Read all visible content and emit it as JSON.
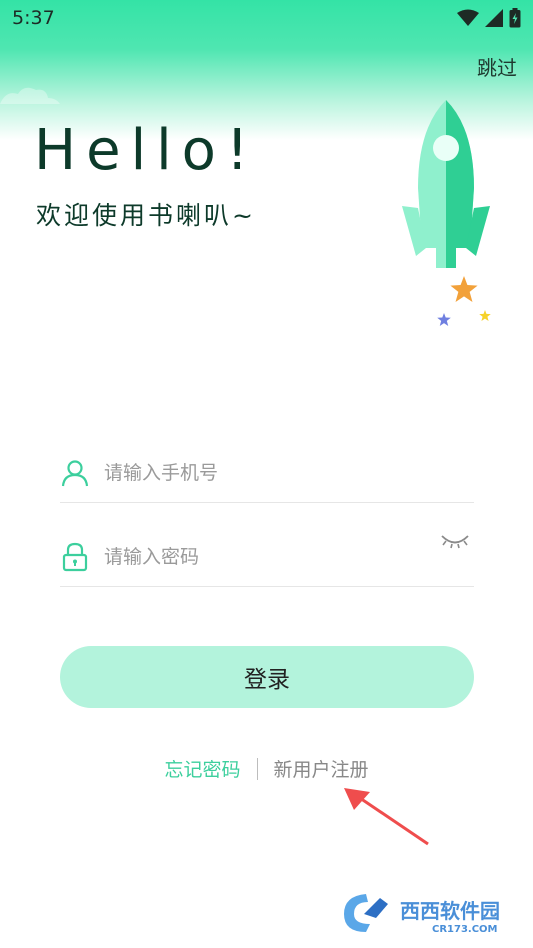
{
  "status_bar": {
    "time": "5:37"
  },
  "header": {
    "skip_label": "跳过"
  },
  "hero": {
    "title": "Hello!",
    "welcome": "欢迎使用书喇叭~"
  },
  "form": {
    "phone_placeholder": "请输入手机号",
    "password_placeholder": "请输入密码",
    "login_label": "登录"
  },
  "links": {
    "forgot_password": "忘记密码",
    "register": "新用户注册"
  },
  "watermark": {
    "brand": "西西软件园",
    "domain": "CR173.COM"
  },
  "colors": {
    "accent": "#3ccf9d",
    "top_gradient": "#34e3a6",
    "button_bg": "#b3f3dc",
    "title_text": "#0d3a2a",
    "arrow": "#ef4d4d"
  },
  "icons": {
    "user": "user-icon",
    "lock": "lock-icon",
    "eye": "eye-closed-icon",
    "rocket": "rocket-illustration",
    "star": "star-icon"
  }
}
